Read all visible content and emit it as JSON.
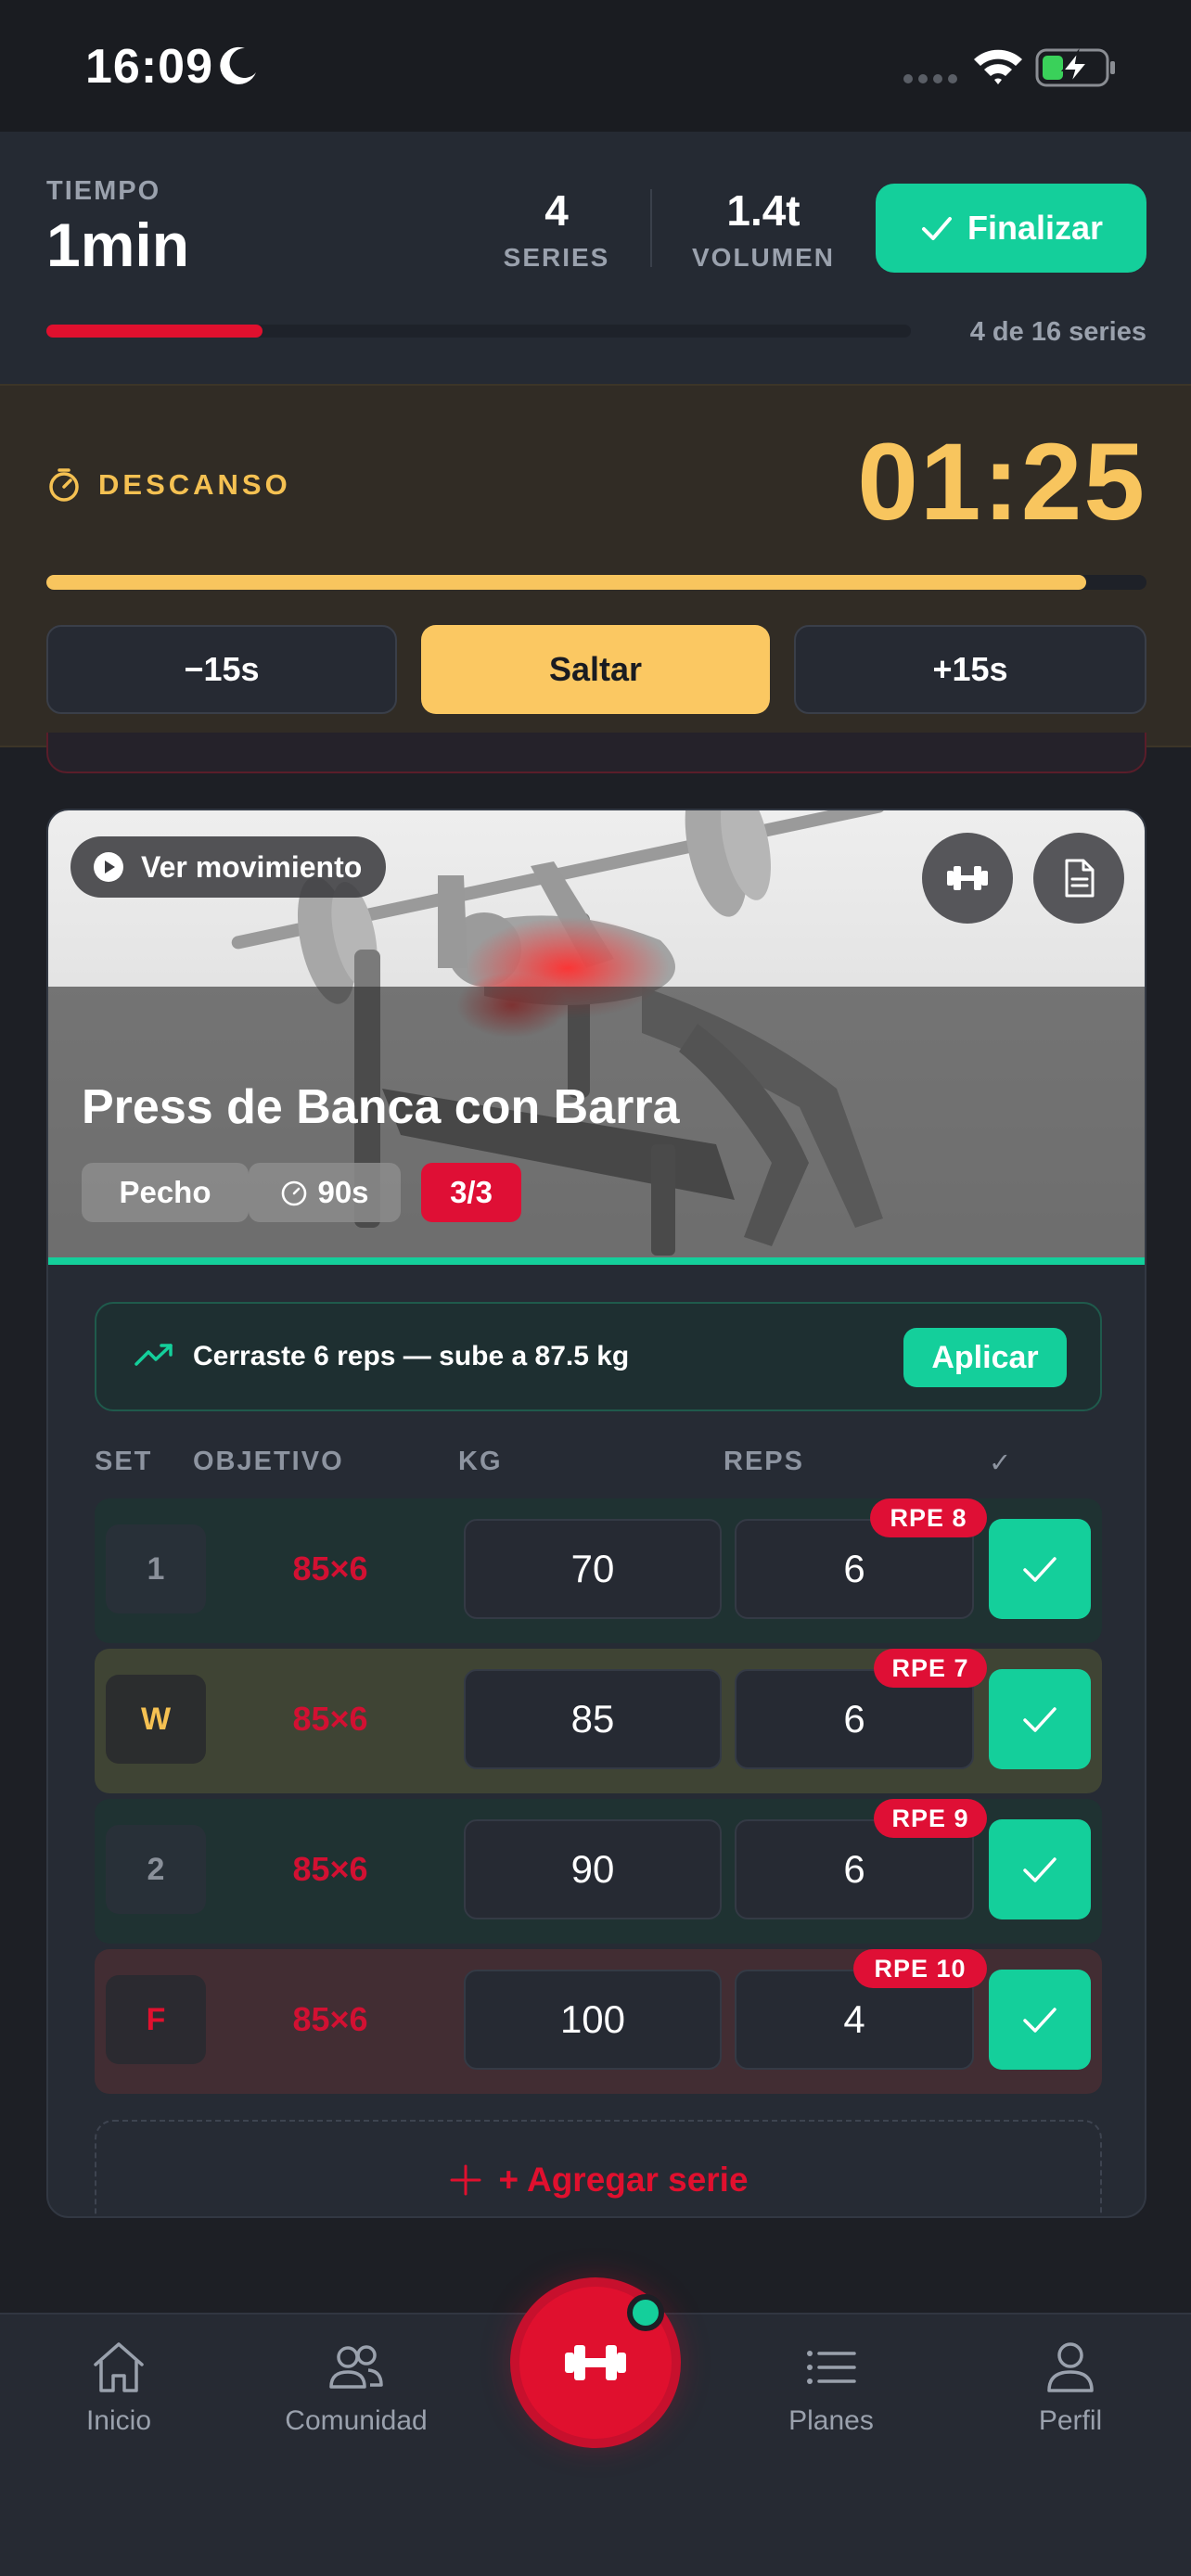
{
  "status_bar": {
    "time": "16:09"
  },
  "header": {
    "time_label": "TIEMPO",
    "time_value": "1min",
    "series_value": "4",
    "series_label": "SERIES",
    "volume_value": "1.4t",
    "volume_label": "VOLUMEN",
    "finish_label": "Finalizar",
    "progress_fraction": 0.25,
    "progress_text": "4 de 16 series"
  },
  "rest": {
    "label": "DESCANSO",
    "countdown": "01:25",
    "progress_fraction": 0.945,
    "minus_label": "−15s",
    "skip_label": "Saltar",
    "plus_label": "+15s"
  },
  "exercise": {
    "watch_label": "Ver movimiento",
    "title": "Press de Banca con Barra",
    "muscle": "Pecho",
    "rest_time": "90s",
    "sets_progress": "3/3",
    "suggestion": "Cerraste 6 reps — sube a 87.5 kg",
    "apply_label": "Aplicar",
    "columns": {
      "set": "SET",
      "objective": "OBJETIVO",
      "kg": "KG",
      "reps": "REPS",
      "check": "✓"
    },
    "sets": [
      {
        "set": "1",
        "target": "85×6",
        "kg": "70",
        "reps": "6",
        "rpe": "RPE 8"
      },
      {
        "set": "W",
        "target": "85×6",
        "kg": "85",
        "reps": "6",
        "rpe": "RPE 7"
      },
      {
        "set": "2",
        "target": "85×6",
        "kg": "90",
        "reps": "6",
        "rpe": "RPE 9"
      },
      {
        "set": "F",
        "target": "85×6",
        "kg": "100",
        "reps": "4",
        "rpe": "RPE 10"
      }
    ],
    "add_set_label": "+ Agregar serie"
  },
  "tabs": {
    "home": "Inicio",
    "community": "Comunidad",
    "plans": "Planes",
    "profile": "Perfil"
  },
  "colors": {
    "accent_green": "#14cf9b",
    "accent_red": "#e0102e",
    "rest_yellow": "#f8c55e"
  }
}
